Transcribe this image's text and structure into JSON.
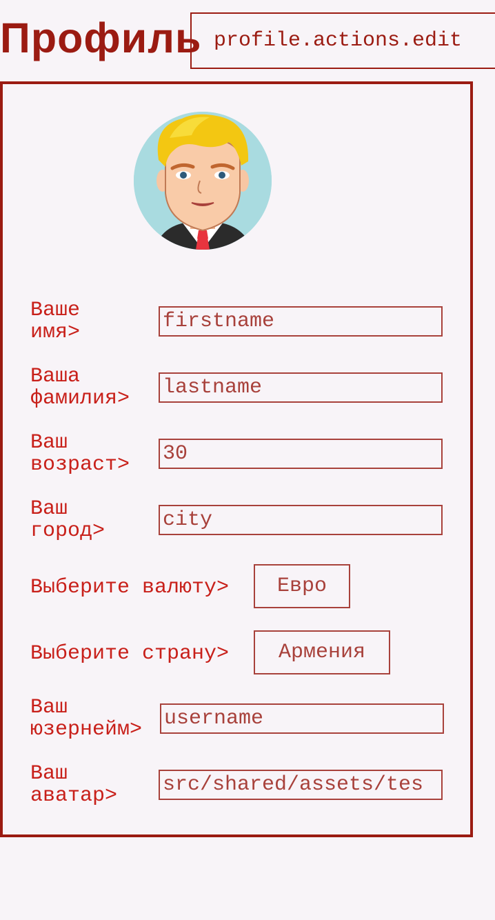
{
  "header": {
    "title": "Профиль",
    "edit_button": "profile.actions.edit"
  },
  "avatar": {
    "icon": "profile-avatar-icon"
  },
  "form": {
    "firstname": {
      "label_line1": "Ваше",
      "label_line2": "имя>",
      "value": "firstname"
    },
    "lastname": {
      "label_line1": "Ваша",
      "label_line2": "фамилия>",
      "value": "lastname"
    },
    "age": {
      "label_line1": "Ваш",
      "label_line2": "возраст>",
      "value": "30"
    },
    "city": {
      "label_line1": "Ваш",
      "label_line2": "город>",
      "value": "city"
    },
    "currency": {
      "label": "Выберите валюту>",
      "value": "Евро"
    },
    "country": {
      "label": "Выберите страну>",
      "value": "Армения"
    },
    "username": {
      "label_line1": "Ваш",
      "label_line2": "юзернейм>",
      "value": "username"
    },
    "avatar": {
      "label_line1": "Ваш",
      "label_line2": "аватар>",
      "value": "src/shared/assets/tes"
    }
  },
  "colors": {
    "background": "#f8f4f8",
    "accent": "#9b1b12",
    "label": "#c8201a",
    "field_border": "#a8413b"
  }
}
